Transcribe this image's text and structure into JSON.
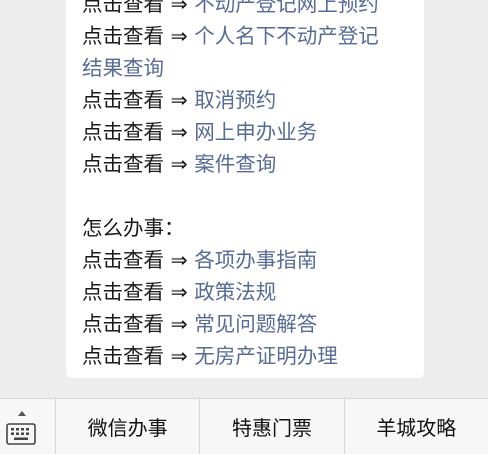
{
  "message": {
    "prefix": "点击查看 ⇒ ",
    "lines": [
      {
        "type": "link",
        "prefix": "点击查看 ⇒ ",
        "text": "不动产登记网上预约"
      },
      {
        "type": "link",
        "prefix": "点击查看 ⇒ ",
        "text": "个人名下不动产登记"
      },
      {
        "type": "link-cont",
        "text": "结果查询"
      },
      {
        "type": "link",
        "prefix": "点击查看 ⇒ ",
        "text": "取消预约"
      },
      {
        "type": "link",
        "prefix": "点击查看 ⇒ ",
        "text": "网上申办业务"
      },
      {
        "type": "link",
        "prefix": "点击查看 ⇒ ",
        "text": "案件查询"
      },
      {
        "type": "blank"
      },
      {
        "type": "heading",
        "text": "怎么办事："
      },
      {
        "type": "link",
        "prefix": "点击查看 ⇒ ",
        "text": "各项办事指南"
      },
      {
        "type": "link",
        "prefix": "点击查看 ⇒ ",
        "text": "政策法规"
      },
      {
        "type": "link",
        "prefix": "点击查看 ⇒ ",
        "text": "常见问题解答"
      },
      {
        "type": "link",
        "prefix": "点击查看 ⇒ ",
        "text": "无房产证明办理"
      }
    ]
  },
  "menu": {
    "keyboard_icon": "keyboard-icon",
    "items": [
      {
        "label": "微信办事"
      },
      {
        "label": "特惠门票"
      },
      {
        "label": "羊城攻略"
      }
    ]
  },
  "colors": {
    "background": "#ededed",
    "bubble": "#ffffff",
    "link": "#576b95",
    "text": "#1a1a1a",
    "menu_bar": "#f7f7f7"
  }
}
